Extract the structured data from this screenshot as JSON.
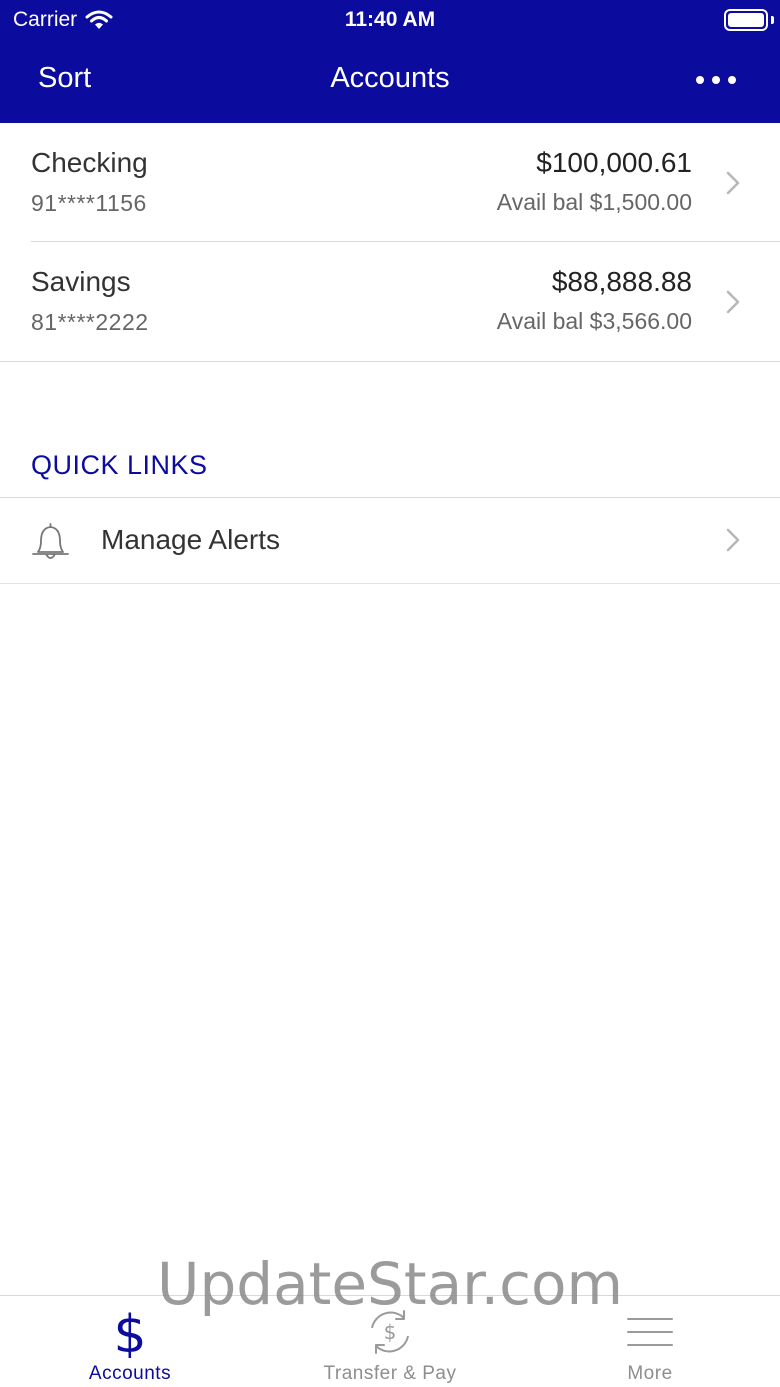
{
  "status_bar": {
    "carrier": "Carrier",
    "time": "11:40 AM"
  },
  "nav": {
    "sort_label": "Sort",
    "title": "Accounts"
  },
  "accounts": [
    {
      "name": "Checking",
      "number": "91****1156",
      "balance": "$100,000.61",
      "available": "Avail bal $1,500.00"
    },
    {
      "name": "Savings",
      "number": "81****2222",
      "balance": "$88,888.88",
      "available": "Avail bal $3,566.00"
    }
  ],
  "quick_links": {
    "title": "QUICK LINKS",
    "items": [
      {
        "label": "Manage Alerts",
        "icon": "bell-icon"
      }
    ]
  },
  "watermark": "UpdateStar.com",
  "tabbar": {
    "tabs": [
      {
        "label": "Accounts",
        "icon": "dollar-icon",
        "active": true
      },
      {
        "label": "Transfer & Pay",
        "icon": "transfer-icon",
        "active": false
      },
      {
        "label": "More",
        "icon": "menu-icon",
        "active": false
      }
    ]
  },
  "colors": {
    "brand": "#0b0b9e",
    "separator": "#d9d9d9",
    "inactive": "#8e8e8e"
  }
}
